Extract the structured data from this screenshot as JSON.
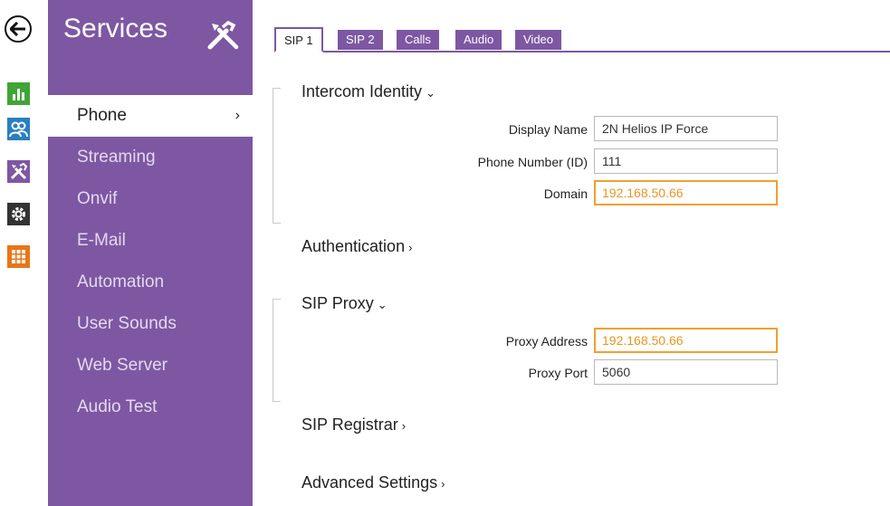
{
  "sidebar": {
    "title": "Services",
    "items": [
      {
        "label": "Phone",
        "chevron": "›"
      },
      {
        "label": "Streaming"
      },
      {
        "label": "Onvif"
      },
      {
        "label": "E-Mail"
      },
      {
        "label": "Automation"
      },
      {
        "label": "User Sounds"
      },
      {
        "label": "Web Server"
      },
      {
        "label": "Audio Test"
      }
    ]
  },
  "rail": {
    "icons": [
      "back-arrow-icon",
      "status-chart-icon",
      "directory-users-icon",
      "services-tools-icon",
      "hardware-gear-icon",
      "system-grid-icon"
    ],
    "colors": {
      "chart": "#3fa535",
      "users": "#2a7fc1",
      "tools": "#7e57a3",
      "gear": "#333333",
      "grid": "#e8751a"
    }
  },
  "tabs": [
    {
      "label": "SIP 1"
    },
    {
      "label": "SIP 2"
    },
    {
      "label": "Calls"
    },
    {
      "label": "Audio"
    },
    {
      "label": "Video"
    }
  ],
  "sections": {
    "intercom_identity": {
      "title": "Intercom Identity",
      "arrow": "⌄",
      "fields": {
        "display_name": {
          "label": "Display Name",
          "value": "2N Helios IP Force"
        },
        "phone_number": {
          "label": "Phone Number (ID)",
          "value": "111"
        },
        "domain": {
          "label": "Domain",
          "value": "192.168.50.66"
        }
      }
    },
    "authentication": {
      "title": "Authentication",
      "arrow": "›"
    },
    "sip_proxy": {
      "title": "SIP Proxy",
      "arrow": "⌄",
      "fields": {
        "proxy_address": {
          "label": "Proxy Address",
          "value": "192.168.50.66"
        },
        "proxy_port": {
          "label": "Proxy Port",
          "value": "5060"
        }
      }
    },
    "sip_registrar": {
      "title": "SIP Registrar",
      "arrow": "›"
    },
    "advanced_settings": {
      "title": "Advanced Settings",
      "arrow": "›"
    }
  },
  "colors": {
    "accent": "#7e57a3",
    "warning": "#f0a030"
  }
}
